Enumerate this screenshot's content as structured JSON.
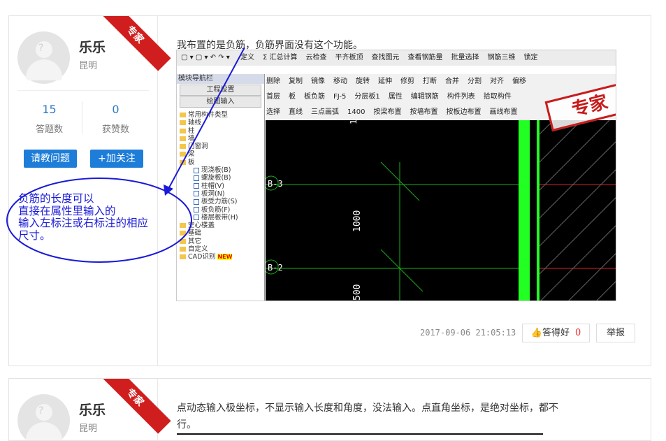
{
  "posts": [
    {
      "user": {
        "name": "乐乐",
        "city": "昆明",
        "badge": "专家"
      },
      "stats": [
        {
          "value": "15",
          "label": "答题数"
        },
        {
          "value": "0",
          "label": "获赞数"
        }
      ],
      "buttons": {
        "ask": "请教问题",
        "follow": "+加关注"
      },
      "content": "我布置的是负筋，负筋界面没有这个功能。",
      "annotation": [
        "负筋的长度可以",
        "直接在属性里输入的",
        "输入左标注或右标注的相应",
        "尺寸。"
      ],
      "time": "2017-09-06 21:05:13",
      "helpful_label": "答得好",
      "helpful_count": "0",
      "report_label": "举报"
    },
    {
      "user": {
        "name": "乐乐",
        "city": "昆明",
        "badge": "专家"
      },
      "content": "点动态输入极坐标，不显示输入长度和角度，没法输入。点直角坐标，是绝对坐标，都不行。"
    }
  ],
  "screenshot": {
    "toolbar1": [
      "定义",
      "Σ 汇总计算",
      "云检查",
      "平齐板顶",
      "查找图元",
      "查看钢筋量",
      "批量选择",
      "钢筋三维",
      "锁定"
    ],
    "toolbar2": [
      "删除",
      "复制",
      "镜像",
      "移动",
      "旋转",
      "延伸",
      "修剪",
      "打断",
      "合并",
      "分割",
      "对齐",
      "偏移"
    ],
    "toolbar3": [
      "首层",
      "板",
      "板负筋",
      "FJ-5",
      "分层板1",
      "属性",
      "编辑钢筋",
      "构件列表",
      "拾取构件"
    ],
    "toolbar4": [
      "选择",
      "直线",
      "三点画弧",
      "1400",
      "按梁布置",
      "按墙布置",
      "按板边布置",
      "画线布置"
    ],
    "stamp": "专家",
    "nav": {
      "title": "模块导航栏",
      "buttons": [
        "工程设置",
        "绘图输入"
      ],
      "tree": [
        "常用构件类型",
        "轴线",
        "柱",
        "墙",
        "门窗洞",
        "梁",
        "板"
      ],
      "subtree": [
        "现浇板(B)",
        "螺旋板(B)",
        "柱帽(V)",
        "板洞(N)",
        "板受力筋(S)",
        "板负筋(F)",
        "楼层板带(H)"
      ],
      "tree_after": [
        "空心楼盖",
        "基础",
        "其它",
        "自定义",
        "CAD识别"
      ],
      "new_tag": "NEW"
    },
    "canvas": {
      "labels": [
        "B-3",
        "B-2"
      ],
      "dims": [
        "1000",
        "500",
        "1"
      ]
    }
  }
}
